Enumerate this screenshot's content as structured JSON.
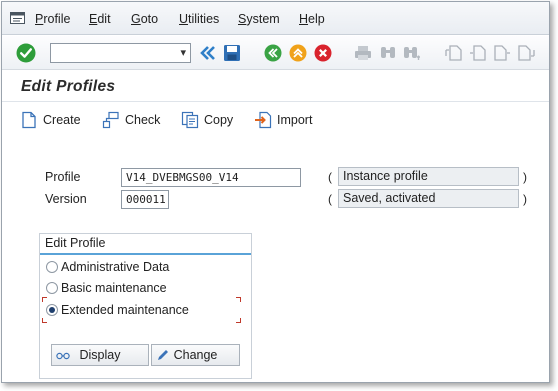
{
  "menu": {
    "items": [
      {
        "label": "Profile",
        "key": "P"
      },
      {
        "label": "Edit",
        "key": "E"
      },
      {
        "label": "Goto",
        "key": "G"
      },
      {
        "label": "Utilities",
        "key": "U"
      },
      {
        "label": "System",
        "key": "S"
      },
      {
        "label": "Help",
        "key": "H"
      }
    ]
  },
  "toolbar": {
    "command_field_value": "",
    "icons": [
      "enter-check-icon",
      "command-dropdown-icon",
      "double-chevron-left-icon",
      "save-icon",
      "back-icon",
      "exit-icon",
      "cancel-icon",
      "print-icon",
      "find-icon",
      "find-next-icon",
      "first-page-icon",
      "previous-page-icon",
      "next-page-icon",
      "last-page-icon"
    ]
  },
  "title": "Edit Profiles",
  "app_toolbar": {
    "create": "Create",
    "check": "Check",
    "copy": "Copy",
    "import": "Import"
  },
  "form": {
    "profile_label": "Profile",
    "profile_value": "V14_DVEBMGS00_V14",
    "profile_type": "Instance profile",
    "version_label": "Version",
    "version_value": "000011",
    "version_status": "Saved, activated"
  },
  "edit_profile": {
    "title": "Edit Profile",
    "options": [
      {
        "label": "Administrative Data",
        "selected": false
      },
      {
        "label": "Basic maintenance",
        "selected": false
      },
      {
        "label": "Extended maintenance",
        "selected": true
      }
    ],
    "display_button": "Display",
    "change_button": "Change"
  },
  "colors": {
    "enter_green": "#2e9d3a",
    "back_green": "#3aa345",
    "exit_orange": "#f0a21a",
    "cancel_red": "#d9232d",
    "save_blue": "#2f6fb5",
    "group_accent": "#5aa3d8"
  }
}
